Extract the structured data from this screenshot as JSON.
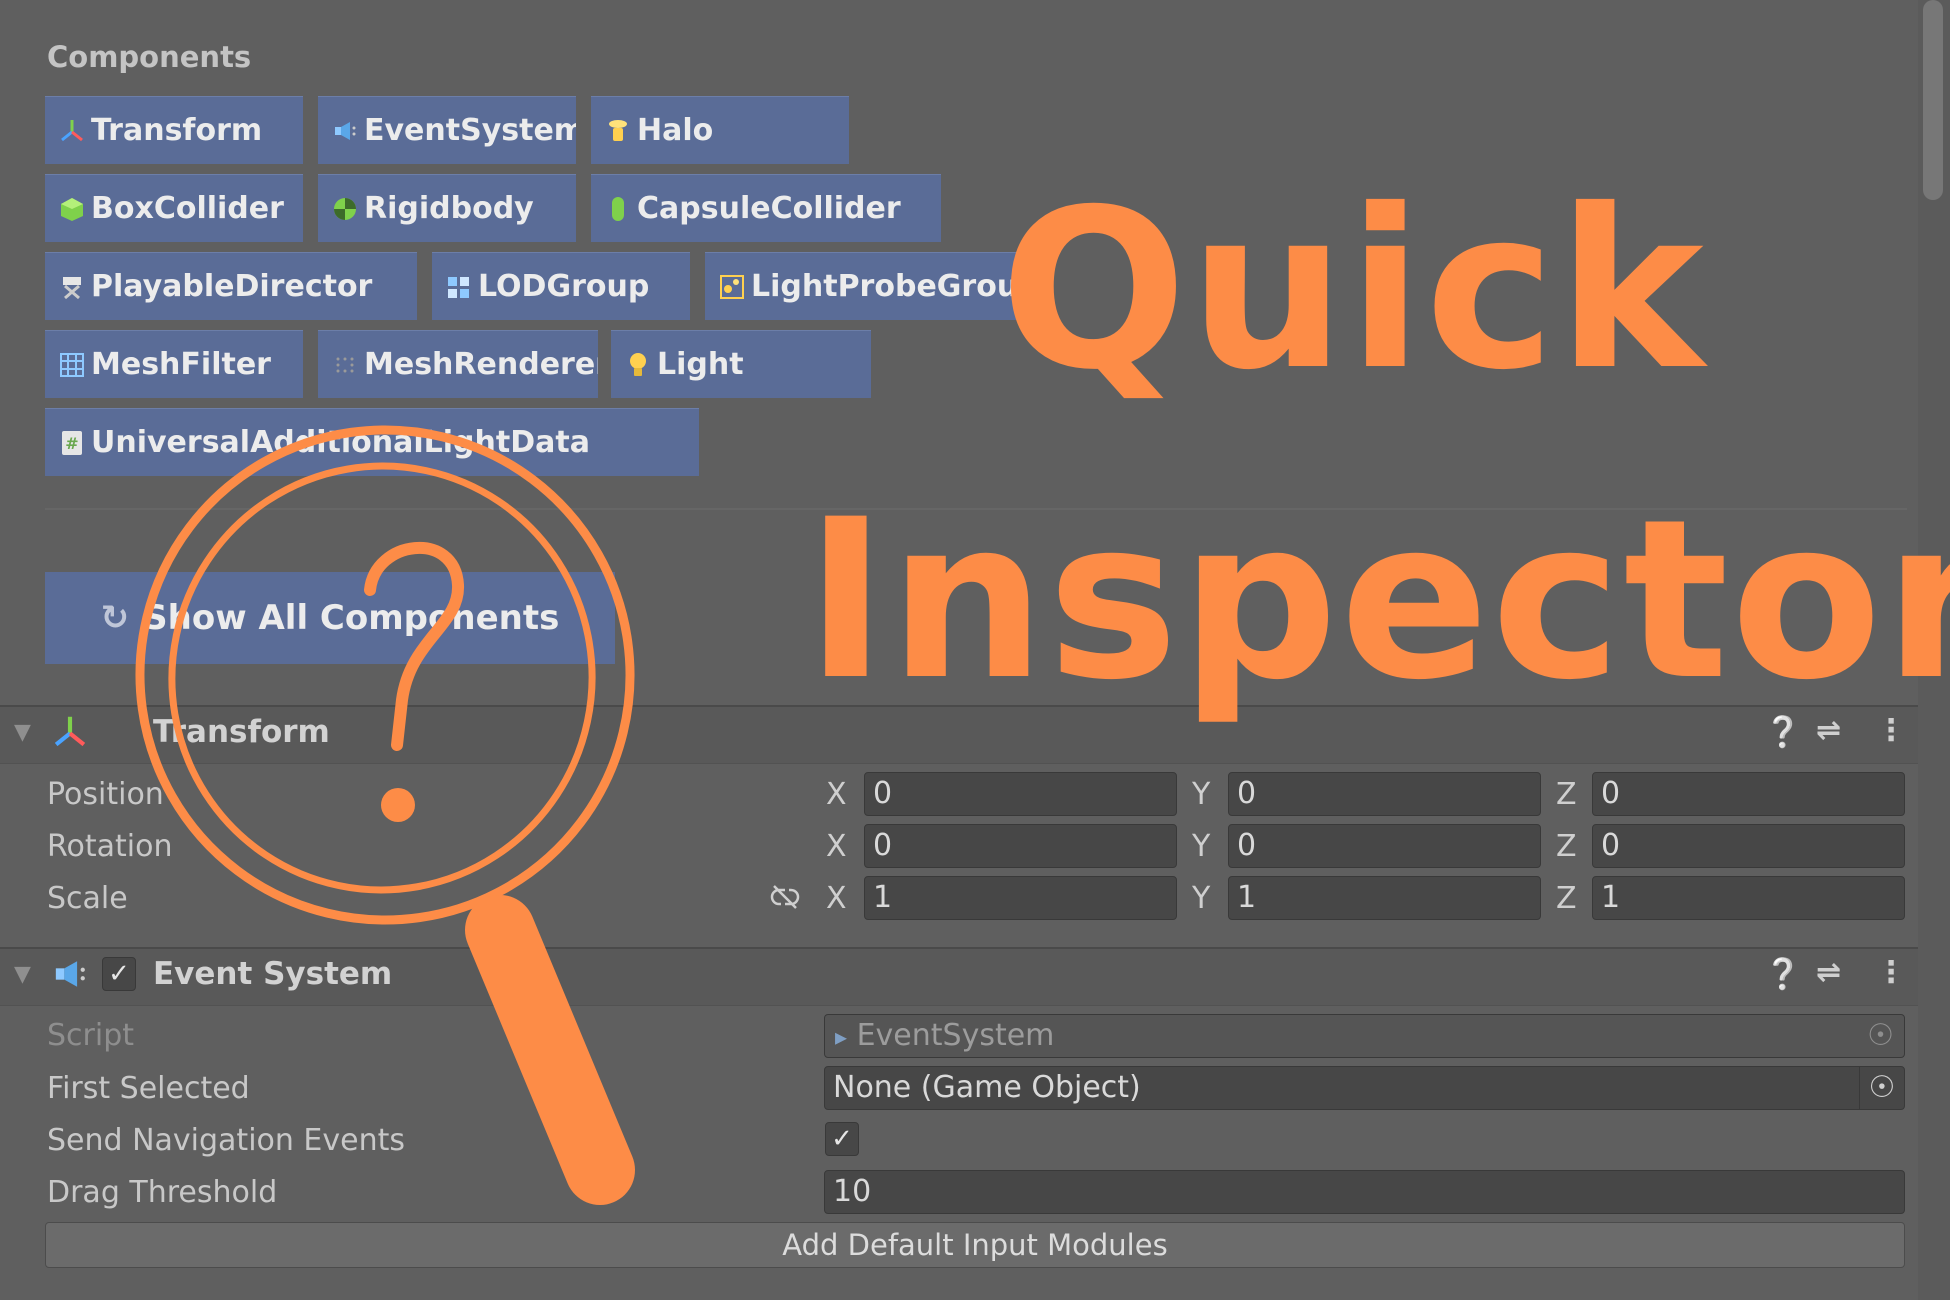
{
  "components_section": {
    "title": "Components",
    "chips": [
      {
        "label": "Transform",
        "icon": "transform-icon"
      },
      {
        "label": "EventSystem",
        "icon": "eventsystem-icon"
      },
      {
        "label": "Halo",
        "icon": "halo-icon"
      },
      {
        "label": "BoxCollider",
        "icon": "boxcollider-icon"
      },
      {
        "label": "Rigidbody",
        "icon": "rigidbody-icon"
      },
      {
        "label": "CapsuleCollider",
        "icon": "capsulecollider-icon"
      },
      {
        "label": "PlayableDirector",
        "icon": "playabledirector-icon"
      },
      {
        "label": "LODGroup",
        "icon": "lodgroup-icon"
      },
      {
        "label": "LightProbeGrou",
        "icon": "lightprobegroup-icon"
      },
      {
        "label": "MeshFilter",
        "icon": "meshfilter-icon"
      },
      {
        "label": "MeshRenderer",
        "icon": "meshrenderer-icon"
      },
      {
        "label": "Light",
        "icon": "light-icon"
      },
      {
        "label": "UniversalAdditionalLightData",
        "icon": "script-icon"
      }
    ],
    "show_all_label": "Show All Components"
  },
  "transform": {
    "title": "Transform",
    "rows": [
      {
        "label": "Position",
        "x": "0",
        "y": "0",
        "z": "0"
      },
      {
        "label": "Rotation",
        "x": "0",
        "y": "0",
        "z": "0"
      },
      {
        "label": "Scale",
        "x": "1",
        "y": "1",
        "z": "1"
      }
    ],
    "axes": {
      "x": "X",
      "y": "Y",
      "z": "Z"
    }
  },
  "event_system": {
    "title": "Event System",
    "enabled": true,
    "script_label": "Script",
    "script_value": "EventSystem",
    "first_selected_label": "First Selected",
    "first_selected_value": "None (Game Object)",
    "send_nav_label": "Send Navigation Events",
    "send_nav_checked": true,
    "drag_label": "Drag Threshold",
    "drag_value": "10",
    "add_modules_label": "Add Default Input Modules"
  },
  "overlay": {
    "title_line1": "Quick",
    "title_line2": "Inspector",
    "accent_color": "#fd8c47"
  }
}
